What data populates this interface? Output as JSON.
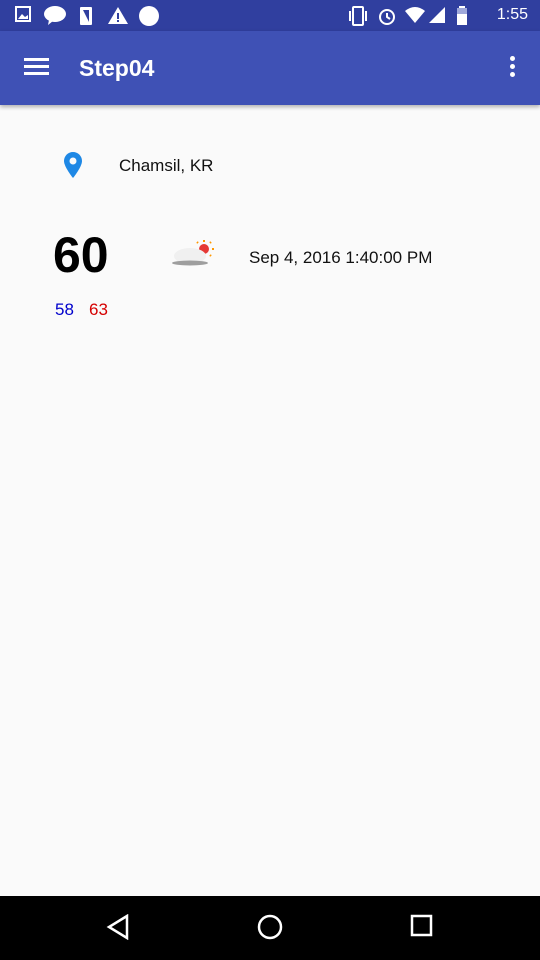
{
  "status_bar": {
    "time": "1:55",
    "icons": [
      "image-icon",
      "talk-icon",
      "sim-icon",
      "warning-icon",
      "circle-icon",
      "vibrate-icon",
      "alarm-icon",
      "wifi-icon",
      "signal-icon",
      "battery-icon"
    ]
  },
  "app_bar": {
    "title": "Step04"
  },
  "weather": {
    "location": "Chamsil, KR",
    "temperature": "60",
    "datetime": "Sep 4, 2016 1:40:00 PM",
    "low": "58",
    "high": "63",
    "condition_icon": "partly-cloudy-icon"
  },
  "colors": {
    "primary": "#3f51b5",
    "primary_dark": "#303f9f",
    "low": "#0000cc",
    "high": "#d50000",
    "pin": "#1e88e5"
  }
}
